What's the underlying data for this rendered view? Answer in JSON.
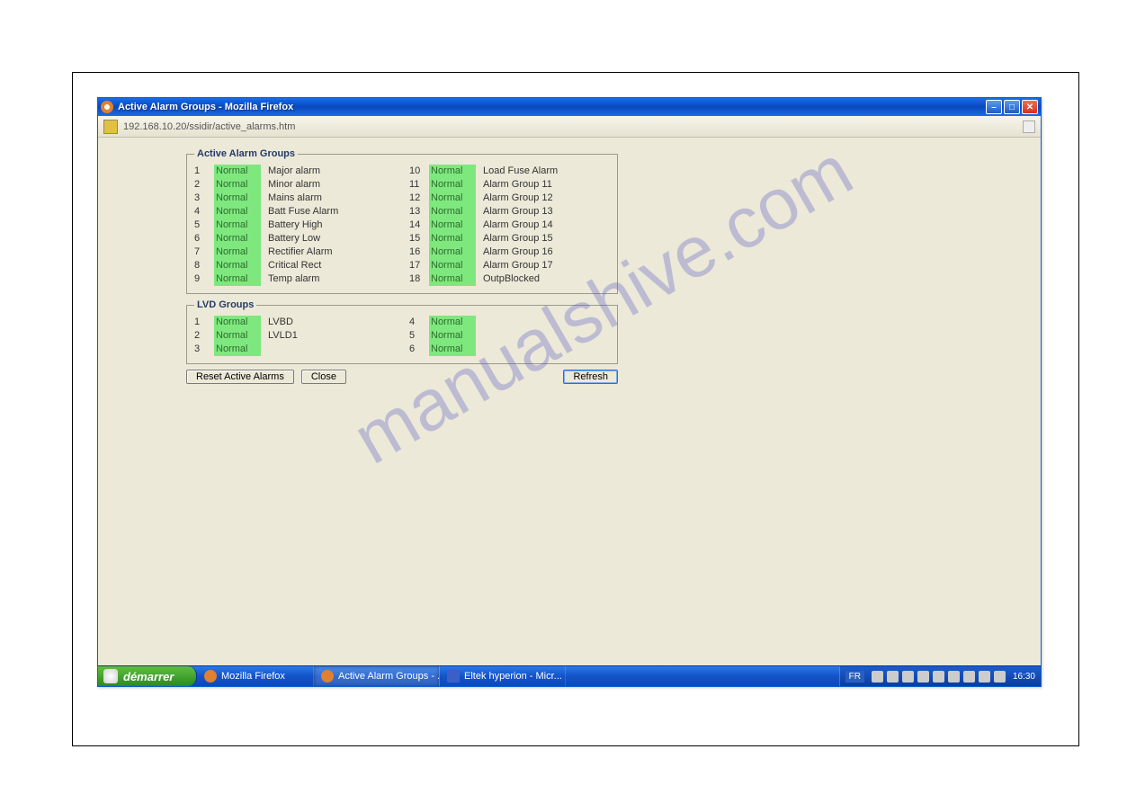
{
  "window": {
    "title": "Active Alarm Groups - Mozilla Firefox",
    "url": "192.168.10.20/ssidir/active_alarms.htm"
  },
  "watermark": "manualshive.com",
  "alarm_groups": {
    "legend": "Active Alarm Groups",
    "left": [
      {
        "n": "1",
        "status": "Normal",
        "label": "Major alarm"
      },
      {
        "n": "2",
        "status": "Normal",
        "label": "Minor alarm"
      },
      {
        "n": "3",
        "status": "Normal",
        "label": "Mains alarm"
      },
      {
        "n": "4",
        "status": "Normal",
        "label": "Batt Fuse Alarm"
      },
      {
        "n": "5",
        "status": "Normal",
        "label": "Battery High"
      },
      {
        "n": "6",
        "status": "Normal",
        "label": "Battery Low"
      },
      {
        "n": "7",
        "status": "Normal",
        "label": "Rectifier Alarm"
      },
      {
        "n": "8",
        "status": "Normal",
        "label": "Critical Rect"
      },
      {
        "n": "9",
        "status": "Normal",
        "label": "Temp alarm"
      }
    ],
    "right": [
      {
        "n": "10",
        "status": "Normal",
        "label": "Load Fuse Alarm"
      },
      {
        "n": "11",
        "status": "Normal",
        "label": "Alarm Group 11"
      },
      {
        "n": "12",
        "status": "Normal",
        "label": "Alarm Group 12"
      },
      {
        "n": "13",
        "status": "Normal",
        "label": "Alarm Group 13"
      },
      {
        "n": "14",
        "status": "Normal",
        "label": "Alarm Group 14"
      },
      {
        "n": "15",
        "status": "Normal",
        "label": "Alarm Group 15"
      },
      {
        "n": "16",
        "status": "Normal",
        "label": "Alarm Group 16"
      },
      {
        "n": "17",
        "status": "Normal",
        "label": "Alarm Group 17"
      },
      {
        "n": "18",
        "status": "Normal",
        "label": "OutpBlocked"
      }
    ]
  },
  "lvd_groups": {
    "legend": "LVD Groups",
    "left": [
      {
        "n": "1",
        "status": "Normal",
        "label": "LVBD"
      },
      {
        "n": "2",
        "status": "Normal",
        "label": "LVLD1"
      },
      {
        "n": "3",
        "status": "Normal",
        "label": ""
      }
    ],
    "right": [
      {
        "n": "4",
        "status": "Normal",
        "label": ""
      },
      {
        "n": "5",
        "status": "Normal",
        "label": ""
      },
      {
        "n": "6",
        "status": "Normal",
        "label": ""
      }
    ]
  },
  "buttons": {
    "reset": "Reset Active Alarms",
    "close": "Close",
    "refresh": "Refresh"
  },
  "taskbar": {
    "start": "démarrer",
    "items": [
      {
        "label": "Mozilla Firefox"
      },
      {
        "label": "Active Alarm Groups - ..."
      },
      {
        "label": "Eltek hyperion - Micr..."
      }
    ],
    "lang": "FR",
    "clock": "16:30"
  }
}
